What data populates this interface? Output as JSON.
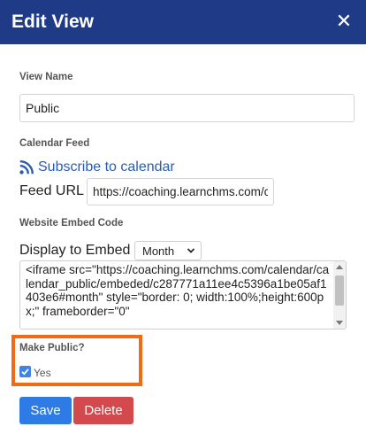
{
  "header": {
    "title": "Edit View",
    "close_glyph": "✕"
  },
  "view_name": {
    "label": "View Name",
    "value": "Public"
  },
  "calendar_feed": {
    "label": "Calendar Feed",
    "subscribe_text": "Subscribe to calendar",
    "feed_url_label": "Feed URL",
    "feed_url_value": "https://coaching.learnchms.com/c"
  },
  "embed": {
    "label": "Website Embed Code",
    "display_label": "Display to Embed",
    "display_value": "Month",
    "code": "<iframe src=\"https://coaching.learnchms.com/calendar/calendar_public/embeded/c287771a11ee4c5396a1be05af1403e6#month\" style=\"border: 0; width:100%;height:600px;\"  frameborder=\"0\""
  },
  "make_public": {
    "label": "Make Public?",
    "option_label": "Yes",
    "checked": true
  },
  "actions": {
    "save_label": "Save",
    "delete_label": "Delete"
  },
  "colors": {
    "header_bg": "#1f3a86",
    "link": "#2a5db0",
    "save": "#2e7be6",
    "delete": "#d24a4e",
    "highlight": "#f26a16"
  }
}
